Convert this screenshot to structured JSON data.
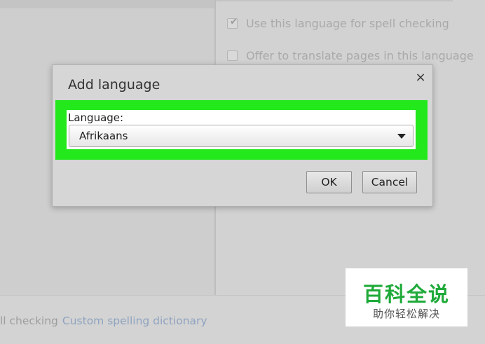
{
  "background": {
    "settings_options": [
      {
        "label": "Use this language for spell checking",
        "checked": true
      },
      {
        "label": "Offer to translate pages in this language",
        "checked": false
      }
    ],
    "bottom_text": "ll checking",
    "bottom_link": "Custom spelling dictionary"
  },
  "dialog": {
    "title": "Add language",
    "close_icon": "×",
    "language_label": "Language:",
    "language_value": "Afrikaans",
    "highlight_color": "#22e81c",
    "ok_label": "OK",
    "cancel_label": "Cancel"
  },
  "watermark": {
    "title": "百科全说",
    "subtitle": "助你轻松解决"
  }
}
